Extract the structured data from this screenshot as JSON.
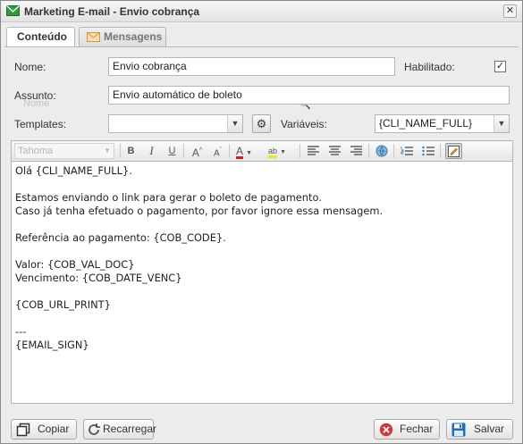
{
  "window": {
    "title": "Marketing E-mail - Envio cobrança",
    "close_glyph": "✕"
  },
  "tabs": [
    {
      "label": "Conteúdo",
      "active": true
    },
    {
      "label": "Mensagens",
      "active": false,
      "icon": "envelope-icon"
    }
  ],
  "form": {
    "nome_label": "Nome:",
    "nome_value": "Envio cobrança",
    "habilitado_label": "Habilitado:",
    "habilitado_checked": true,
    "assunto_label": "Assunto:",
    "assunto_value": "Envio automático de boleto",
    "templates_label": "Templates:",
    "templates_value": "",
    "variaveis_label": "Variáveis:",
    "variaveis_value": "{CLI_NAME_FULL}",
    "ghost_text": "Nome"
  },
  "toolbar": {
    "font_family": "Tahoma",
    "buttons": [
      "bold-icon",
      "italic-icon",
      "underline-icon",
      "grow-font-icon",
      "shrink-font-icon",
      "font-color-icon",
      "highlight-icon",
      "align-left-icon",
      "align-center-icon",
      "align-right-icon",
      "link-icon",
      "ordered-list-icon",
      "unordered-list-icon",
      "source-edit-icon"
    ]
  },
  "editor": {
    "lines": [
      "Olá {CLI_NAME_FULL}.",
      "",
      "Estamos enviando o link para gerar o boleto de pagamento.",
      "Caso já tenha efetuado o pagamento, por favor ignore essa mensagem.",
      "",
      "Referência ao pagamento: {COB_CODE}.",
      "",
      "Valor: {COB_VAL_DOC}",
      "Vencimento: {COB_DATE_VENC}",
      "",
      "{COB_URL_PRINT}",
      "",
      "---",
      "{EMAIL_SIGN}"
    ]
  },
  "footer": {
    "copy_label": "Copiar",
    "reload_label": "Recarregar",
    "close_label": "Fechar",
    "save_label": "Salvar"
  },
  "colors": {
    "accent_green": "#2e9a3c",
    "close_red": "#d03a3a",
    "save_blue": "#1f6fb2"
  }
}
